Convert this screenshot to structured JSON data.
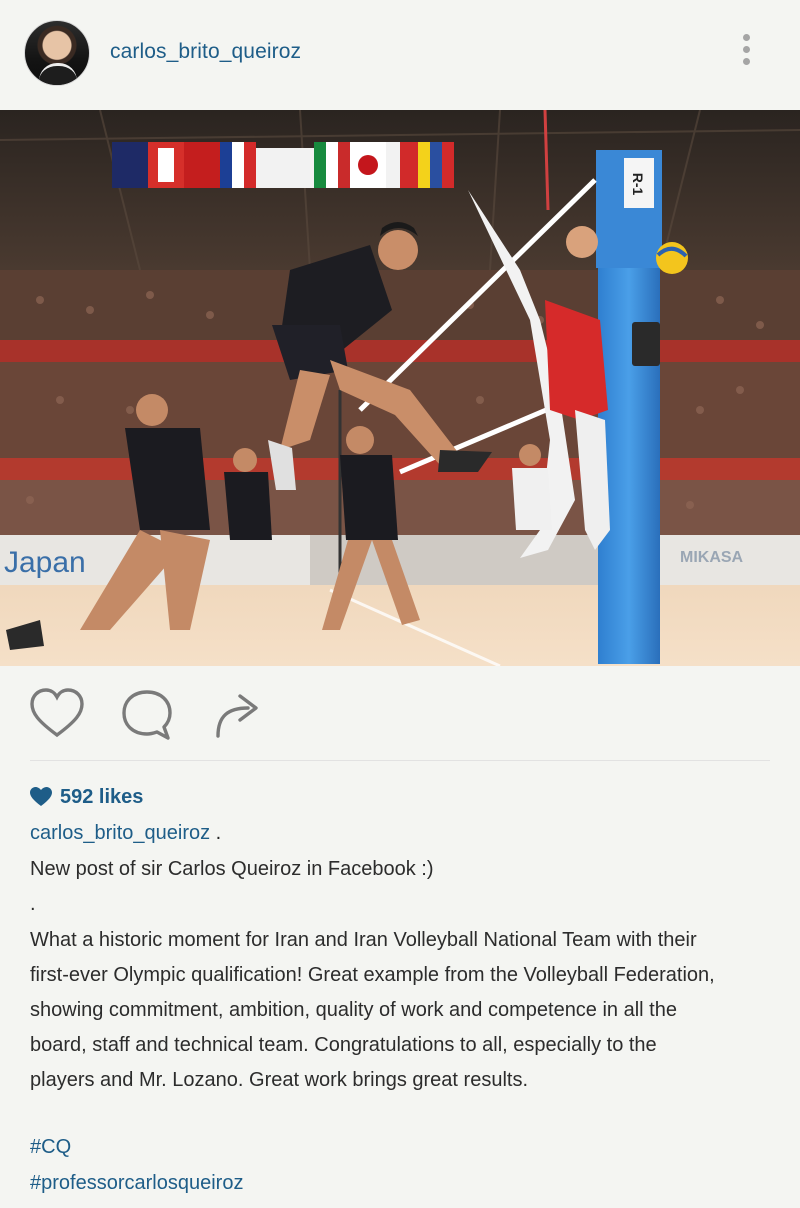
{
  "post": {
    "username": "carlos_brito_queiroz",
    "likes_label": "592 likes",
    "caption_user": "carlos_brito_queiroz",
    "caption_user_suffix": " .",
    "caption_lines": [
      "New post of sir Carlos Queiroz in Facebook :)",
      ".",
      "What a historic moment for Iran and Iran Volleyball National Team with their",
      "first-ever Olympic qualification! Great example from the Volleyball Federation,",
      "showing commitment, ambition, quality of work and competence in all the",
      "board, staff and technical team. Congratulations to all, especially to the",
      "players and Mr. Lozano. Great work brings great results."
    ],
    "hashtags": [
      "#CQ",
      "#professorcarlosqueiroz"
    ]
  },
  "photo": {
    "pole_label": "R-1",
    "banner_left": "Japan",
    "banner_right": "MIKASA"
  },
  "icons": {
    "avatar": "avatar-photo",
    "more": "more-vertical-icon",
    "like": "heart-icon",
    "comment": "comment-icon",
    "share": "share-icon",
    "likes": "heart-filled-icon"
  },
  "colors": {
    "link": "#1e5d88",
    "text": "#2c2c2c",
    "background": "#f4f5f2",
    "icon": "#7a7a7a"
  }
}
